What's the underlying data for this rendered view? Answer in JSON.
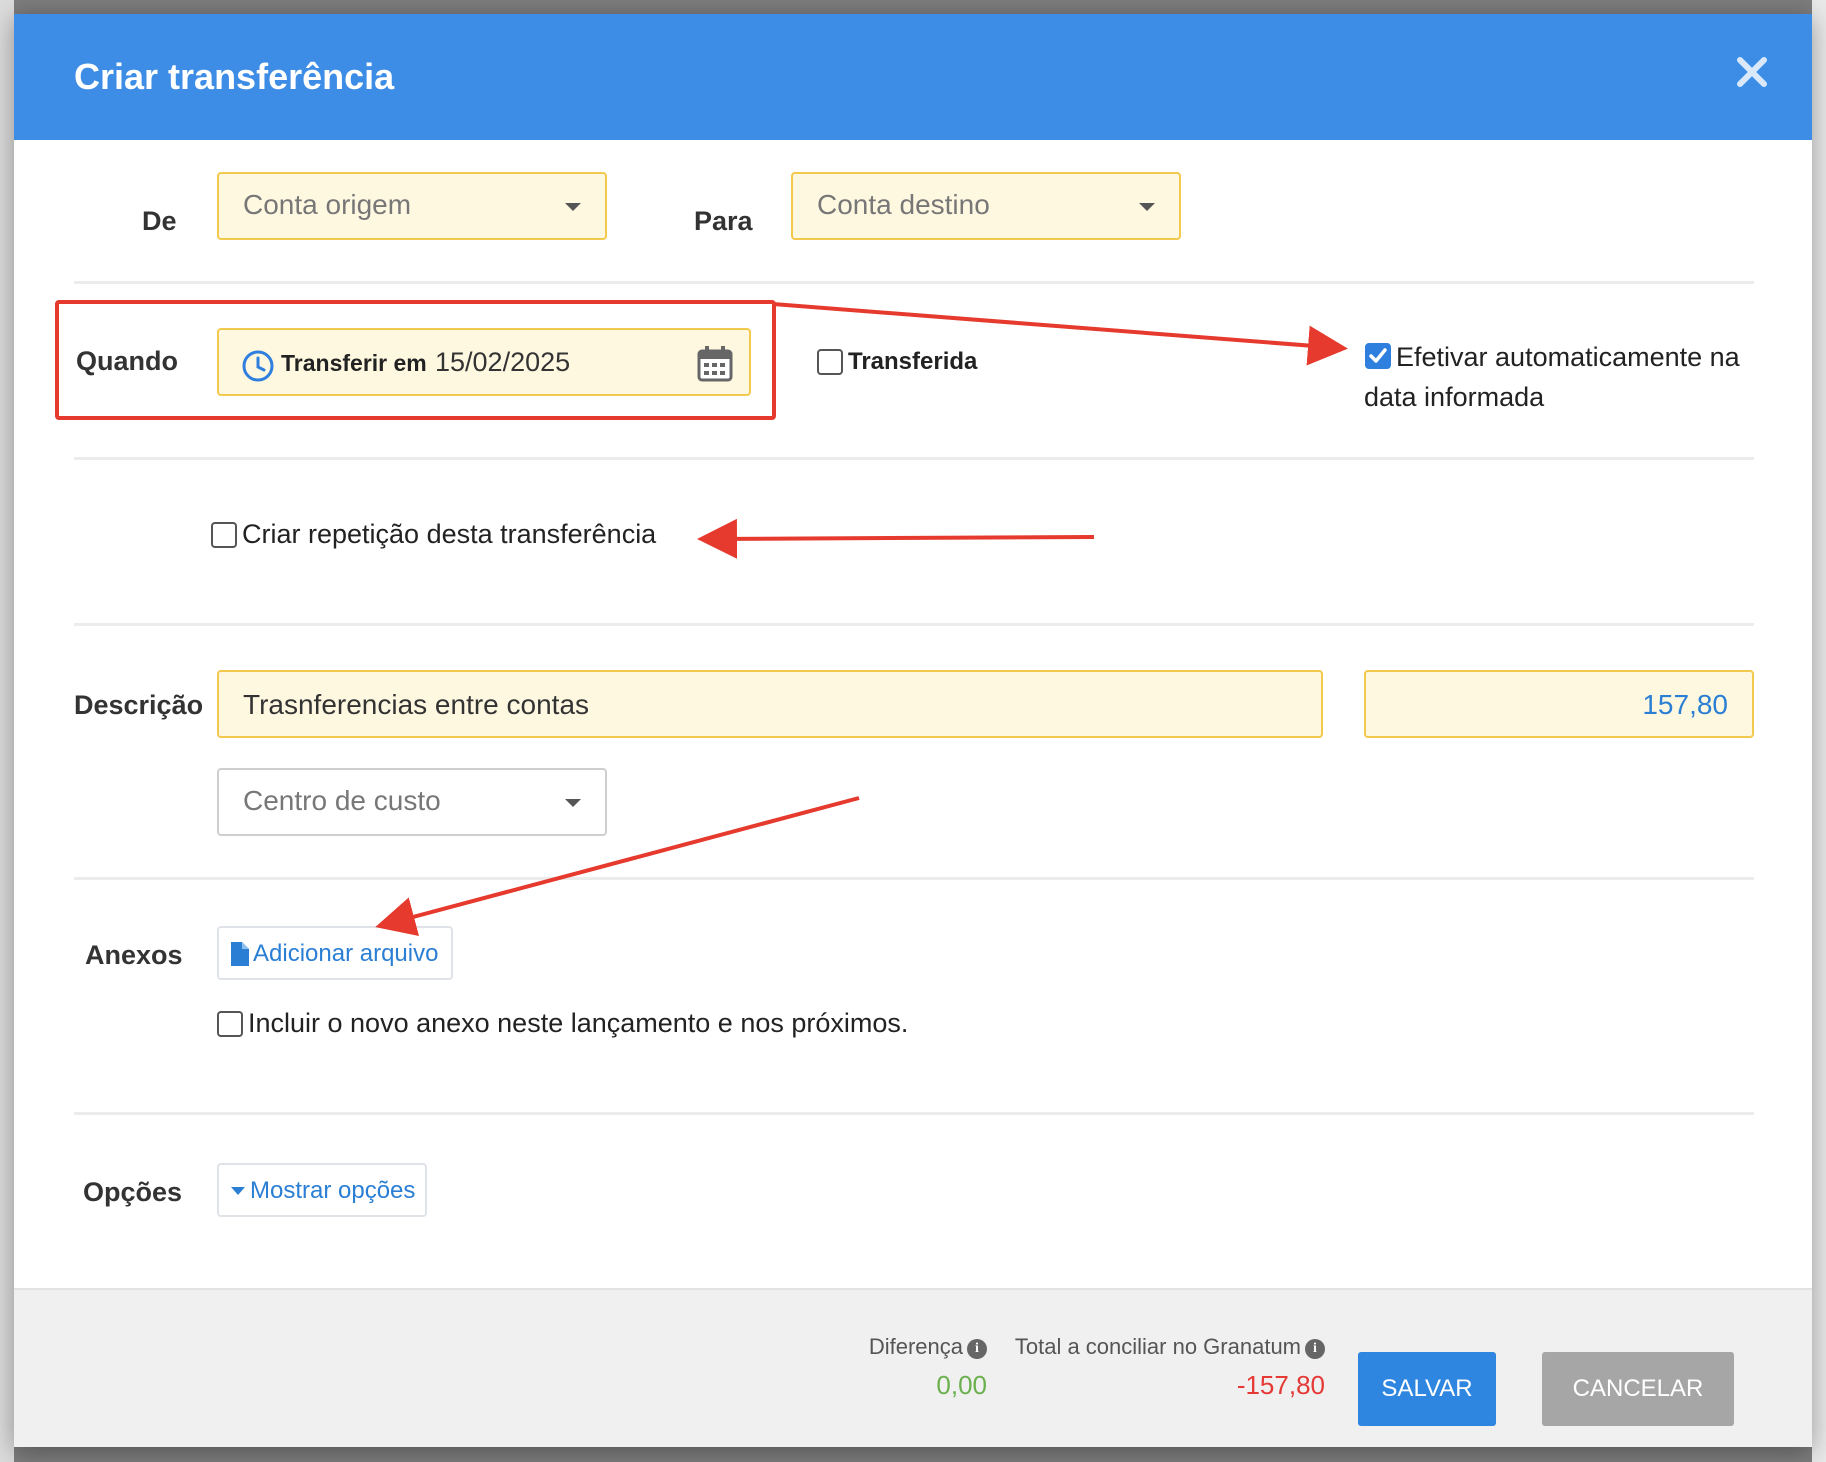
{
  "dialog": {
    "title": "Criar transferência"
  },
  "from": {
    "label": "De",
    "placeholder": "Conta origem"
  },
  "to": {
    "label": "Para",
    "placeholder": "Conta destino"
  },
  "when": {
    "label": "Quando",
    "prefix": "Transferir em",
    "date": "15/02/2025",
    "transferred_label": "Transferida",
    "transferred_checked": false,
    "auto_label_line1": "Efetivar automaticamente na",
    "auto_label_line2": "data informada",
    "auto_checked": true
  },
  "repeat": {
    "label": "Criar repetição desta transferência",
    "checked": false
  },
  "description": {
    "label": "Descrição",
    "value": "Trasnferencias entre contas",
    "amount": "157,80",
    "cost_center_placeholder": "Centro de custo"
  },
  "attachments": {
    "label": "Anexos",
    "add_button": "Adicionar arquivo",
    "include_label": "Incluir o novo anexo neste lançamento e nos próximos.",
    "include_checked": false
  },
  "options": {
    "label": "Opções",
    "toggle": "Mostrar opções"
  },
  "footer": {
    "difference_label": "Diferença",
    "difference_value": "0,00",
    "total_label": "Total a conciliar no Granatum",
    "total_value": "-157,80",
    "save": "SALVAR",
    "cancel": "CANCELAR"
  },
  "colors": {
    "header": "#3d8de6",
    "field_bg": "#fff8e1",
    "field_border": "#f2c94c",
    "link": "#2a7fd4",
    "positive": "#6ab04c",
    "negative": "#e53935",
    "save": "#2f86e0",
    "cancel": "#a6a6a6",
    "annotation": "#e53a2d"
  },
  "icons": [
    "close-icon",
    "clock-icon",
    "calendar-icon",
    "file-icon",
    "caret-down-icon",
    "info-icon",
    "checkmark-icon"
  ]
}
